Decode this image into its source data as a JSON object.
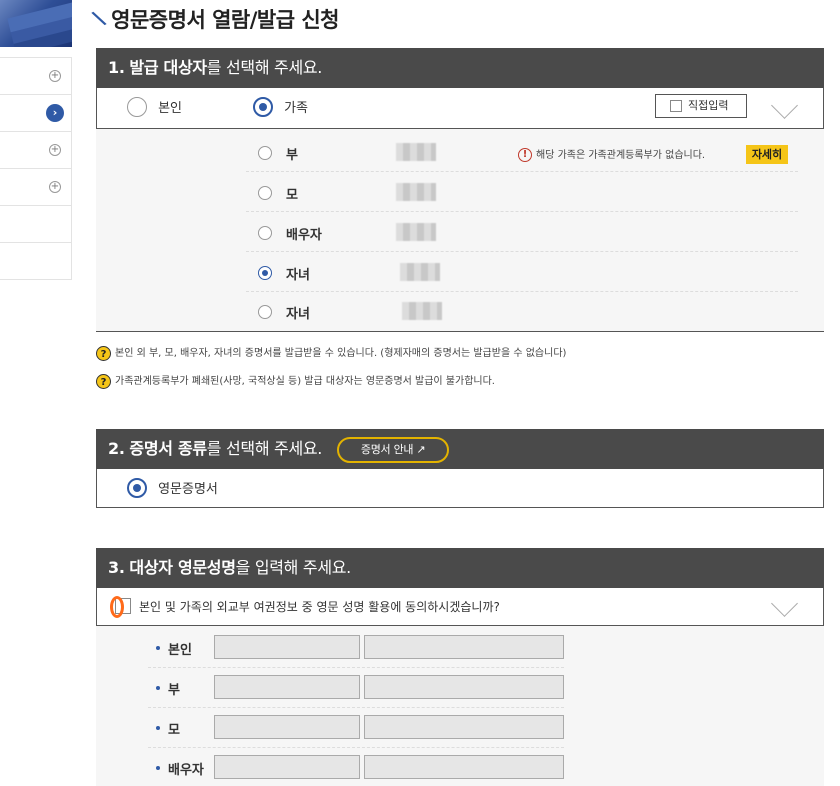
{
  "title": "영문증명서 열람/발급 신청",
  "sidebar": {
    "items": [
      {
        "icon": "plus-circle-icon"
      },
      {
        "icon": "arrow-circle-icon",
        "active": true
      },
      {
        "icon": "plus-circle-icon"
      },
      {
        "icon": "plus-circle-icon"
      },
      {
        "icon": ""
      },
      {
        "icon": ""
      }
    ]
  },
  "section1": {
    "num": "1.",
    "bold": "발급 대상자",
    "rest": "를 선택해 주세요.",
    "self_label": "본인",
    "family_label": "가족",
    "direct_input_label": "직접입력",
    "family": [
      {
        "relation": "부",
        "selected": false
      },
      {
        "relation": "모",
        "selected": false
      },
      {
        "relation": "배우자",
        "selected": false
      },
      {
        "relation": "자녀",
        "selected": true
      },
      {
        "relation": "자녀",
        "selected": false
      }
    ],
    "warning": "해당 가족은 가족관계등록부가 없습니다.",
    "detail_button": "자세히",
    "notes": [
      "본인 외 부, 모, 배우자, 자녀의 증명서를 발급받을 수 있습니다. (형제자매의 증명서는 발급받을 수 없습니다)",
      "가족관계등록부가 폐쇄된(사망, 국적상실 등) 발급 대상자는 영문증명서 발급이 불가합니다."
    ]
  },
  "section2": {
    "num": "2.",
    "bold": "증명서 종류",
    "rest": "를 선택해 주세요.",
    "guide_button": "증명서 안내 ↗",
    "option": "영문증명서"
  },
  "section3": {
    "num": "3.",
    "bold": "대상자 영문성명",
    "rest": "을 입력해 주세요.",
    "agree_text": "본인 및 가족의 외교부 여권정보 중 영문 성명 활용에 동의하시겠습니까?",
    "rows": [
      "본인",
      "부",
      "모",
      "배우자"
    ]
  },
  "colors": {
    "header_bg": "#4a4a4a",
    "accent": "#2f5aa6",
    "highlight": "#f5c518",
    "focus_ring": "#ff6a1a"
  }
}
